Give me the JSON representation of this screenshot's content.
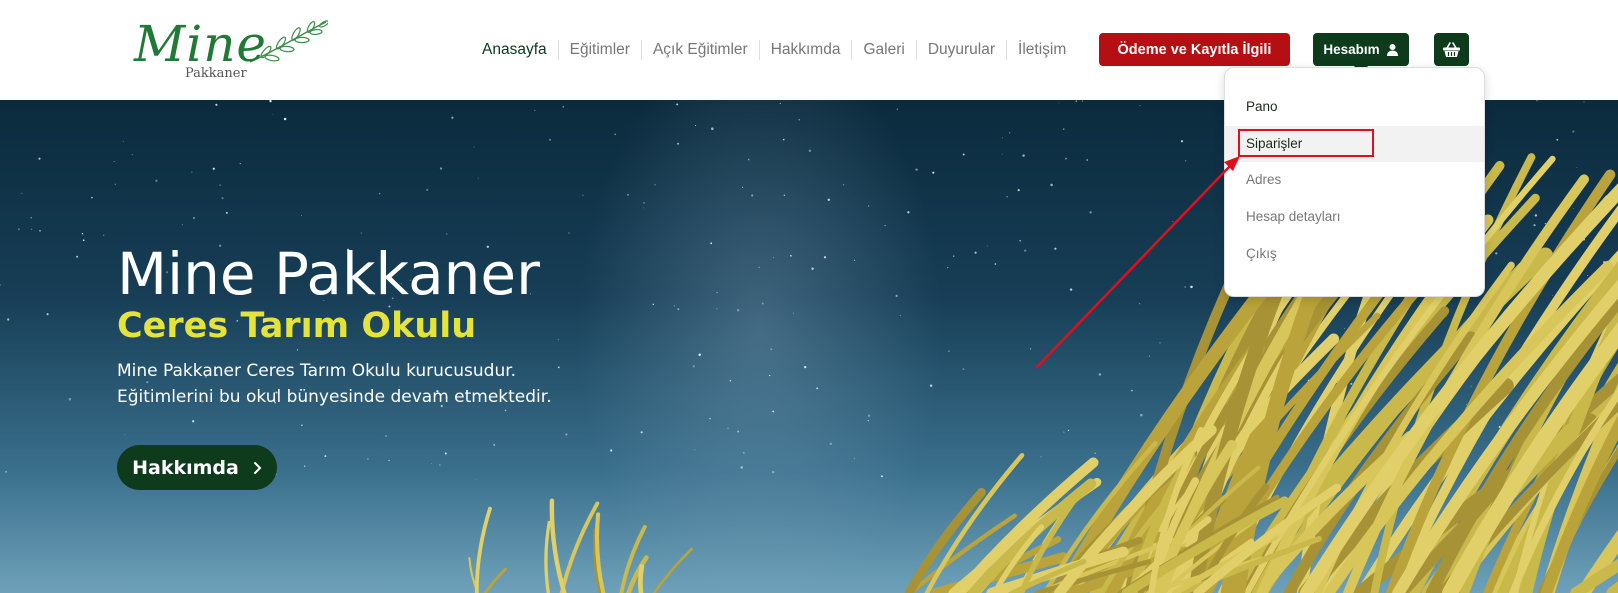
{
  "brand": {
    "script_name": "Mine",
    "sub_name": "Pakkaner"
  },
  "nav": [
    {
      "label": "Anasayfa"
    },
    {
      "label": "Eğitimler"
    },
    {
      "label": "Açık Eğitimler"
    },
    {
      "label": "Hakkımda"
    },
    {
      "label": "Galeri"
    },
    {
      "label": "Duyurular"
    },
    {
      "label": "İletişim"
    }
  ],
  "header_buttons": {
    "payment_label": "Ödeme ve Kayıtla İlgili",
    "account_label": "Hesabım"
  },
  "account_menu": {
    "items": [
      {
        "label": "Pano"
      },
      {
        "label": "Siparişler"
      },
      {
        "label": "Adres"
      },
      {
        "label": "Hesap detayları"
      },
      {
        "label": "Çıkış"
      }
    ],
    "active_index": 1
  },
  "hero": {
    "title": "Mine Pakkaner",
    "subtitle": "Ceres Tarım Okulu",
    "description": "Mine Pakkaner Ceres Tarım Okulu kurucusudur. Eğitimlerini bu okul bünyesinde devam etmektedir.",
    "button_label": "Hakkımda"
  },
  "colors": {
    "brand_green": "#0d3b1c",
    "logo_green": "#1f7a35",
    "payment_red": "#b50f14",
    "subtitle_yellow": "#e5e23a",
    "annotation_red": "#e0101a"
  },
  "icons": {
    "account": "user-icon",
    "cart": "basket-icon",
    "hero_button": "chevron-right-icon"
  }
}
